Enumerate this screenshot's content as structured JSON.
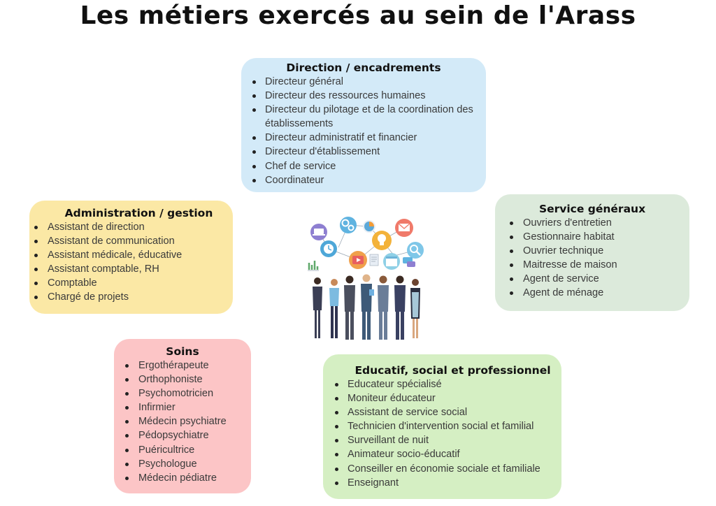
{
  "title": "Les métiers exercés au sein de l'Arass",
  "colors": {
    "direction_bg": "#d3eaf8",
    "administration_bg": "#fbe8a5",
    "services_bg": "#dceadb",
    "soins_bg": "#fcc5c6",
    "educatif_bg": "#d5efc3"
  },
  "direction": {
    "heading": "Direction / encadrements",
    "items": [
      "Directeur général",
      "Directeur des ressources humaines",
      "Directeur du pilotage et de la coordination des établissements",
      "Directeur administratif et financier",
      "Directeur d'établissement",
      "Chef de service",
      "Coordinateur"
    ]
  },
  "administration": {
    "heading": "Administration / gestion",
    "items": [
      "Assistant de direction",
      "Assistant de communication",
      "Assistant médicale, éducative",
      "Assistant comptable, RH",
      "Comptable",
      "Chargé de projets"
    ]
  },
  "services": {
    "heading": "Service généraux",
    "items": [
      "Ouvriers d'entretien",
      "Gestionnaire habitat",
      "Ouvrier technique",
      "Maitresse de maison",
      "Agent de service",
      "Agent de ménage"
    ]
  },
  "soins": {
    "heading": "Soins",
    "items": [
      "Ergothérapeute",
      "Orthophoniste",
      "Psychomotricien",
      "Infirmier",
      "Médecin psychiatre",
      "Pédopsychiatre",
      "Puéricultrice",
      "Psychologue",
      "Médecin pédiatre"
    ]
  },
  "educatif": {
    "heading": "Educatif, social et professionnel",
    "items": [
      "Educateur spécialisé",
      "Moniteur éducateur",
      "Assistant de service social",
      "Technicien d'intervention social et familial",
      "Surveillant de nuit",
      "Animateur socio-éducatif",
      "Conseiller en économie sociale et familiale",
      "Enseignant"
    ]
  },
  "illustration": {
    "icons": [
      "laptop-icon",
      "gears-icon",
      "pie-chart-icon",
      "mail-icon",
      "clock-icon",
      "lightbulb-icon",
      "video-icon",
      "document-icon",
      "calendar-icon",
      "magnifier-icon",
      "bar-chart-icon",
      "chat-icon"
    ]
  }
}
